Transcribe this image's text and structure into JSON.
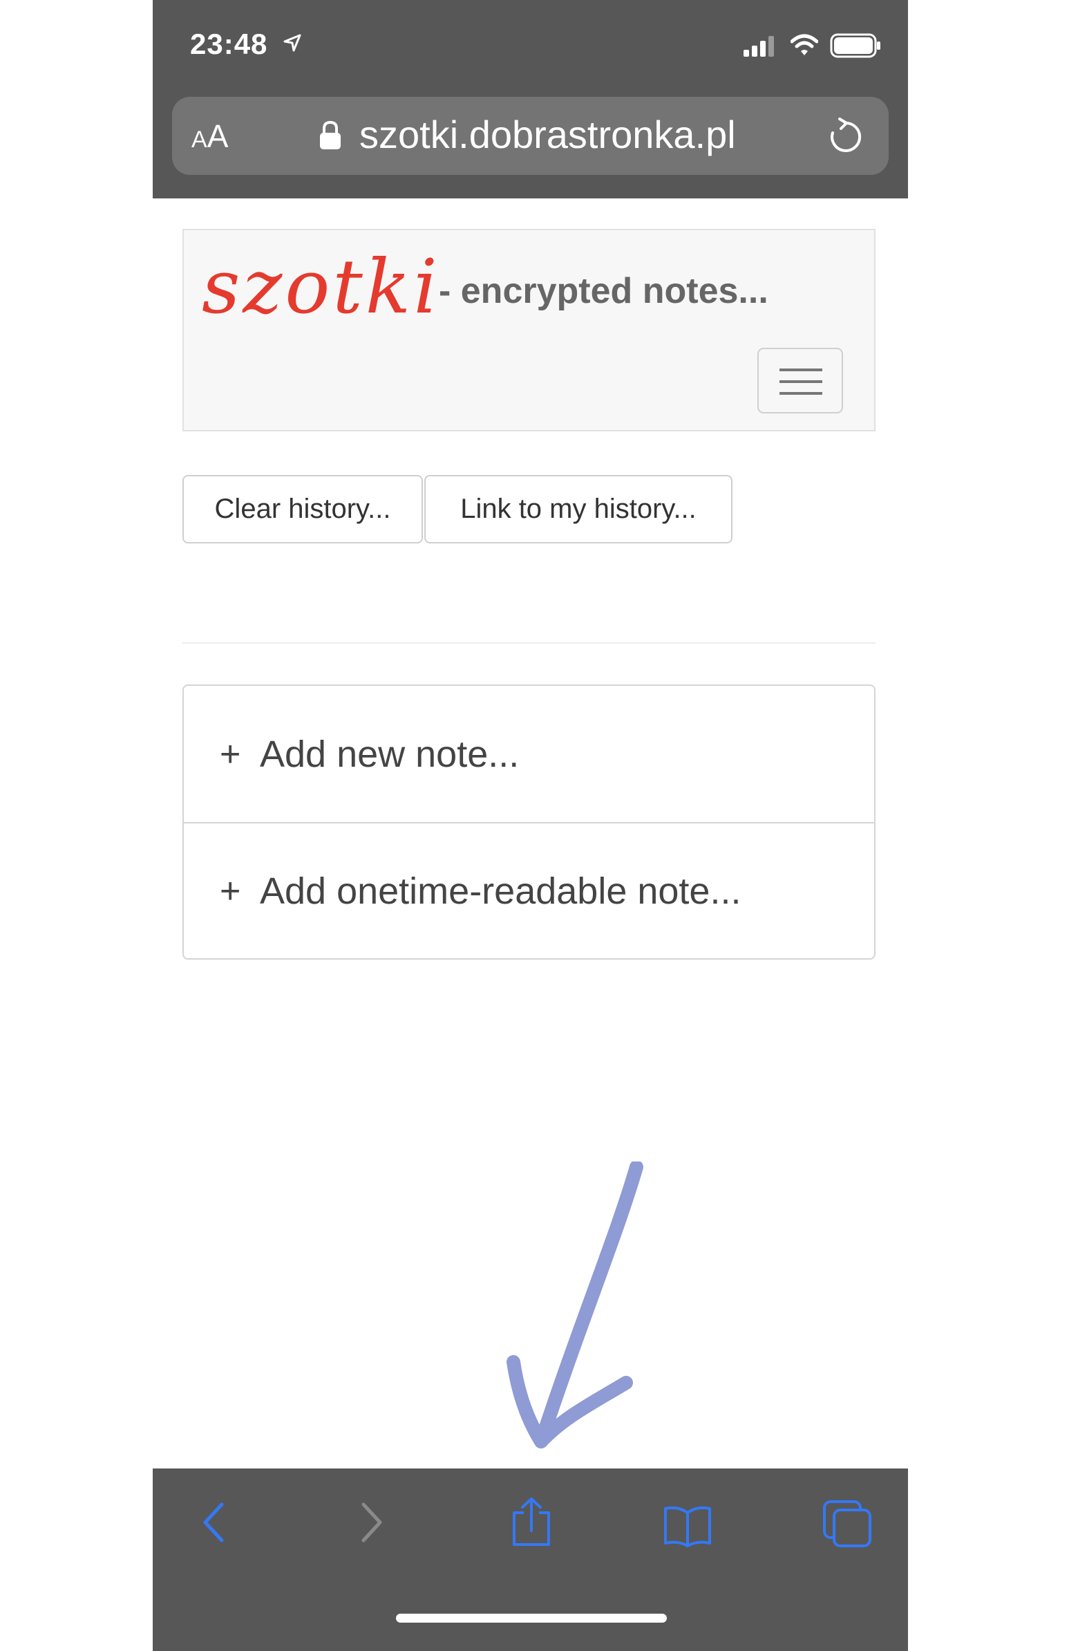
{
  "status_bar": {
    "time": "23:48",
    "icons": [
      "location-arrow-icon",
      "signal-icon",
      "wifi-icon",
      "battery-icon"
    ]
  },
  "url_bar": {
    "text_size_label_small": "A",
    "text_size_label_large": "A",
    "url": "szotki.dobrastronka.pl",
    "icons": [
      "lock-icon",
      "reload-icon"
    ]
  },
  "header": {
    "logo_text": "szotki",
    "tagline": "- encrypted notes...",
    "menu_icon": "hamburger-icon"
  },
  "history_buttons": {
    "clear_label": "Clear history...",
    "link_label": "Link to my history..."
  },
  "notes": {
    "add_note_plus": "+",
    "add_note_label": "Add new note...",
    "add_onetime_plus": "+",
    "add_onetime_label": "Add onetime-readable note..."
  },
  "toolbar": {
    "icons": [
      "back-icon",
      "forward-icon",
      "share-icon",
      "bookmarks-icon",
      "tabs-icon"
    ]
  },
  "colors": {
    "chrome": "#575757",
    "logo": "#e53a2e",
    "toolbar_icon": "#3478f6",
    "annotation": "#8e9bd4"
  }
}
